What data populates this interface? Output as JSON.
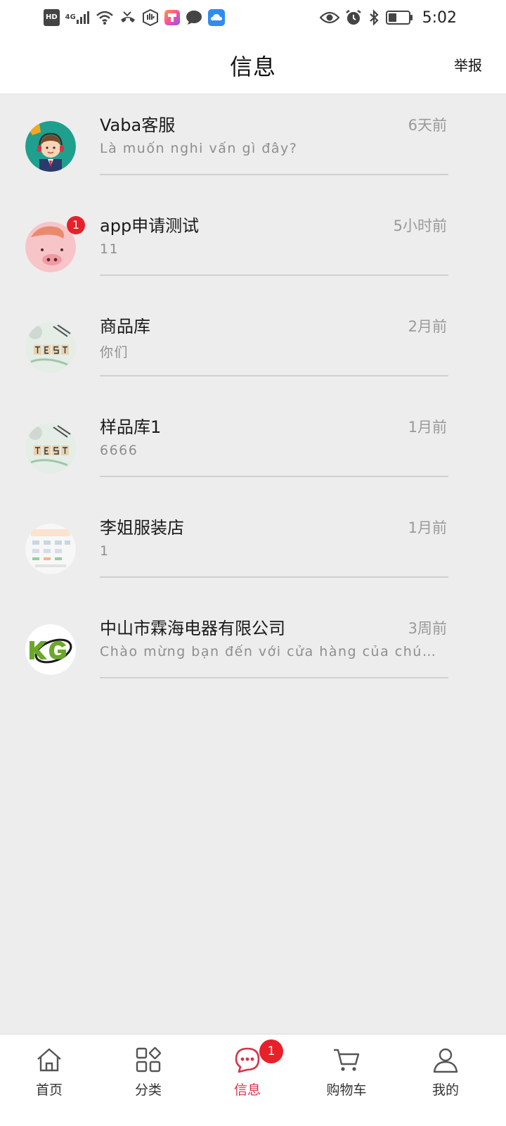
{
  "status_bar": {
    "time": "5:02",
    "left_icons": [
      "hd-icon",
      "4g-signal-icon",
      "wifi-icon",
      "missed-call-icon",
      "hand-icon",
      "app-icon",
      "chat-icon",
      "cloud-icon"
    ],
    "right_icons": [
      "eye-icon",
      "alarm-icon",
      "bluetooth-icon",
      "battery-icon"
    ],
    "hd_label": "HD",
    "network_label": "4G"
  },
  "header": {
    "title": "信息",
    "report": "举报"
  },
  "messages": [
    {
      "name": "Vaba客服",
      "time": "6天前",
      "preview": "Là muốn nghi vấn gì đây?",
      "badge": "",
      "avatar": "customer-service-avatar"
    },
    {
      "name": "app申请测试",
      "time": "5小时前",
      "preview": "11",
      "badge": "1",
      "avatar": "pig-avatar"
    },
    {
      "name": "商品库",
      "time": "2月前",
      "preview": "你们",
      "badge": "",
      "avatar": "test-photo-avatar"
    },
    {
      "name": "样品库1",
      "time": "1月前",
      "preview": "6666",
      "badge": "",
      "avatar": "test-photo-avatar"
    },
    {
      "name": "李姐服装店",
      "time": "1月前",
      "preview": "1",
      "badge": "",
      "avatar": "screenshot-avatar"
    },
    {
      "name": "中山市霖海电器有限公司",
      "time": "3周前",
      "preview": "Chào mừng bạn đến với cửa hàng của chúng tôi",
      "badge": "",
      "avatar": "kg-logo-avatar"
    }
  ],
  "tabbar": {
    "tabs": [
      {
        "label": "首页",
        "icon": "home-icon",
        "active": false
      },
      {
        "label": "分类",
        "icon": "category-icon",
        "active": false
      },
      {
        "label": "信息",
        "icon": "message-icon",
        "active": true,
        "badge": "1"
      },
      {
        "label": "购物车",
        "icon": "cart-icon",
        "active": false
      },
      {
        "label": "我的",
        "icon": "profile-icon",
        "active": false
      }
    ]
  },
  "colors": {
    "accent": "#d8334a",
    "badge": "#e8202a",
    "background": "#ededed"
  }
}
